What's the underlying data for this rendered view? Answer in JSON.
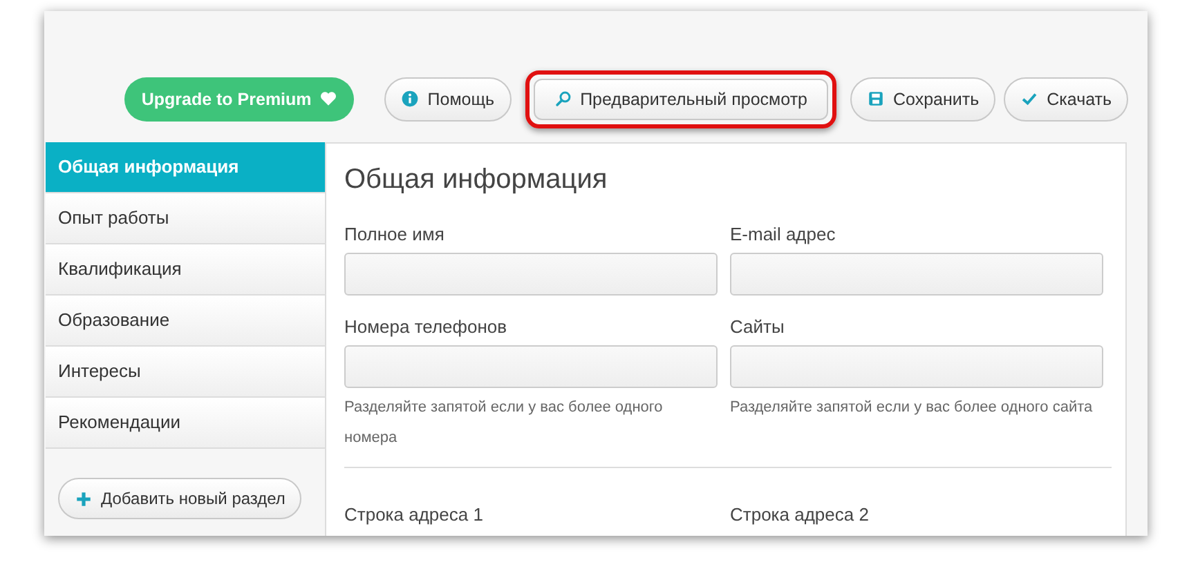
{
  "toolbar": {
    "buttons": [
      {
        "kind": "premium",
        "label": "Upgrade to Premium",
        "highlighted": false
      },
      {
        "kind": "help",
        "label": "Помощь",
        "highlighted": false
      },
      {
        "kind": "preview",
        "label": "Предварительный просмотр",
        "highlighted": true
      },
      {
        "kind": "save",
        "label": "Сохранить",
        "highlighted": false
      },
      {
        "kind": "download",
        "label": "Скачать",
        "highlighted": false
      }
    ]
  },
  "sidebar": {
    "items": [
      {
        "label": "Общая информация",
        "selected": true
      },
      {
        "label": "Опыт работы",
        "selected": false
      },
      {
        "label": "Квалификация",
        "selected": false
      },
      {
        "label": "Образование",
        "selected": false
      },
      {
        "label": "Интересы",
        "selected": false
      },
      {
        "label": "Рекомендации",
        "selected": false
      }
    ],
    "add_button": "Добавить новый раздел"
  },
  "content": {
    "heading": "Общая информация",
    "sections": [
      {
        "fields": [
          {
            "kind": "input",
            "label": "Полное имя"
          },
          {
            "kind": "input",
            "label": "E-mail адрес"
          }
        ]
      },
      {
        "fields": [
          {
            "kind": "input",
            "label": "Номера телефонов",
            "hint": "Разделяйте запятой если у вас более одного номера"
          },
          {
            "kind": "input",
            "label": "Сайты",
            "hint": "Разделяйте запятой если у вас более одного сайта"
          }
        ]
      },
      {
        "fields": [
          {
            "kind": "label",
            "label": "Строка адреса 1"
          },
          {
            "kind": "label",
            "label": "Строка адреса 2"
          }
        ]
      }
    ]
  }
}
